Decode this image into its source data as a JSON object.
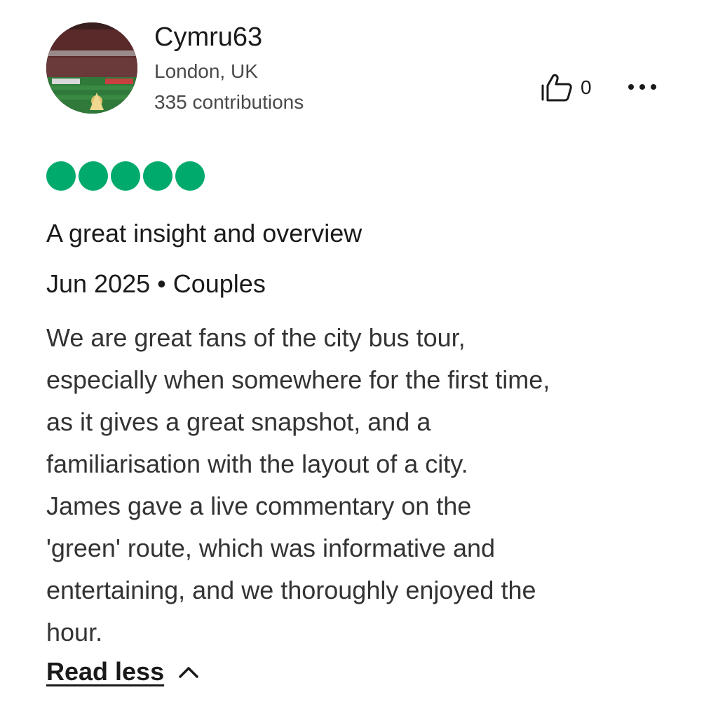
{
  "reviewer": {
    "username": "Cymru63",
    "location": "London, UK",
    "contributions": "335 contributions",
    "avatar_icon": "stadium-photo"
  },
  "actions": {
    "helpful_icon": "thumbs-up-icon",
    "helpful_count": "0",
    "more_icon": "more-dots-icon"
  },
  "review": {
    "rating": 5,
    "rating_max": 5,
    "rating_color": "#00aa6c",
    "title": "A great insight and overview",
    "meta": "Jun 2025 • Couples",
    "text": "We are great fans of the city bus tour,\nespecially when somewhere for the first time,\nas it gives a great snapshot, and a\nfamiliarisation with the layout of a city.\nJames gave a live commentary on the\n'green' route, which was informative and\nentertaining, and we thoroughly enjoyed the\nhour.",
    "read_less_label": "Read less",
    "read_less_icon": "chevron-up-icon"
  }
}
